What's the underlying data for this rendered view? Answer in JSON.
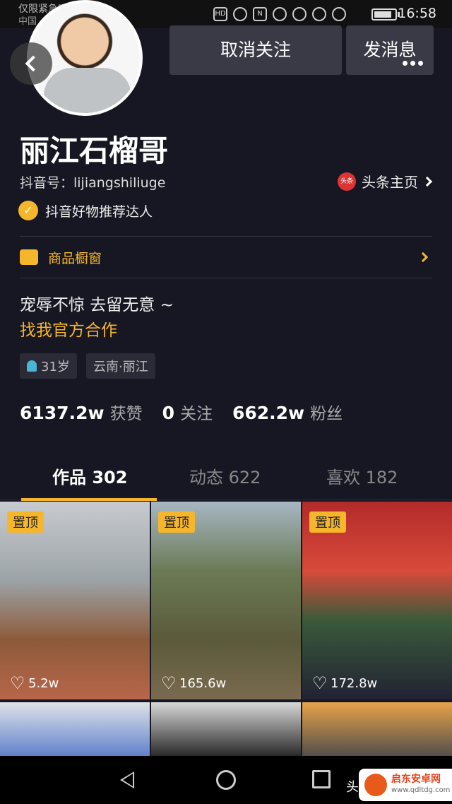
{
  "status_bar": {
    "carrier_line1": "仅限紧急呼叫",
    "carrier_line2": "中国",
    "time": "16:58",
    "icons": [
      "hd-icon",
      "eye-icon",
      "nfc-icon",
      "alarm-icon",
      "bluetooth-icon",
      "location-icon",
      "mute-icon",
      "battery-icon"
    ]
  },
  "header": {
    "unfollow_label": "取消关注",
    "message_label": "发消息"
  },
  "profile": {
    "name": "丽江石榴哥",
    "douyin_id": "抖音号：lijiangshiliuge",
    "toutiao_label": "头条主页",
    "toutiao_icon_text": "头条",
    "verified_label": "抖音好物推荐达人",
    "shop_label": "商品橱窗",
    "bio_line1": "宠辱不惊 去留无意 ~",
    "bio_link": "找我官方合作",
    "tag_age": "31岁",
    "tag_location": "云南·丽江"
  },
  "stats": {
    "likes_value": "6137.2w",
    "likes_label": "获赞",
    "following_value": "0",
    "following_label": "关注",
    "followers_value": "662.2w",
    "followers_label": "粉丝"
  },
  "tabs": {
    "works": "作品 302",
    "moments": "动态 622",
    "likes": "喜欢 182",
    "active": "works"
  },
  "videos": [
    {
      "pinned_label": "置顶",
      "likes": "5.2w"
    },
    {
      "pinned_label": "置顶",
      "likes": "165.6w"
    },
    {
      "pinned_label": "置顶",
      "likes": "172.8w"
    }
  ],
  "navbar": {
    "extra_text": "头"
  },
  "watermark": {
    "title": "启东安卓网",
    "url": "www.qdltdg.com"
  },
  "colors": {
    "background": "#161722",
    "accent": "#f5b62c",
    "button_bg": "#393a45"
  }
}
